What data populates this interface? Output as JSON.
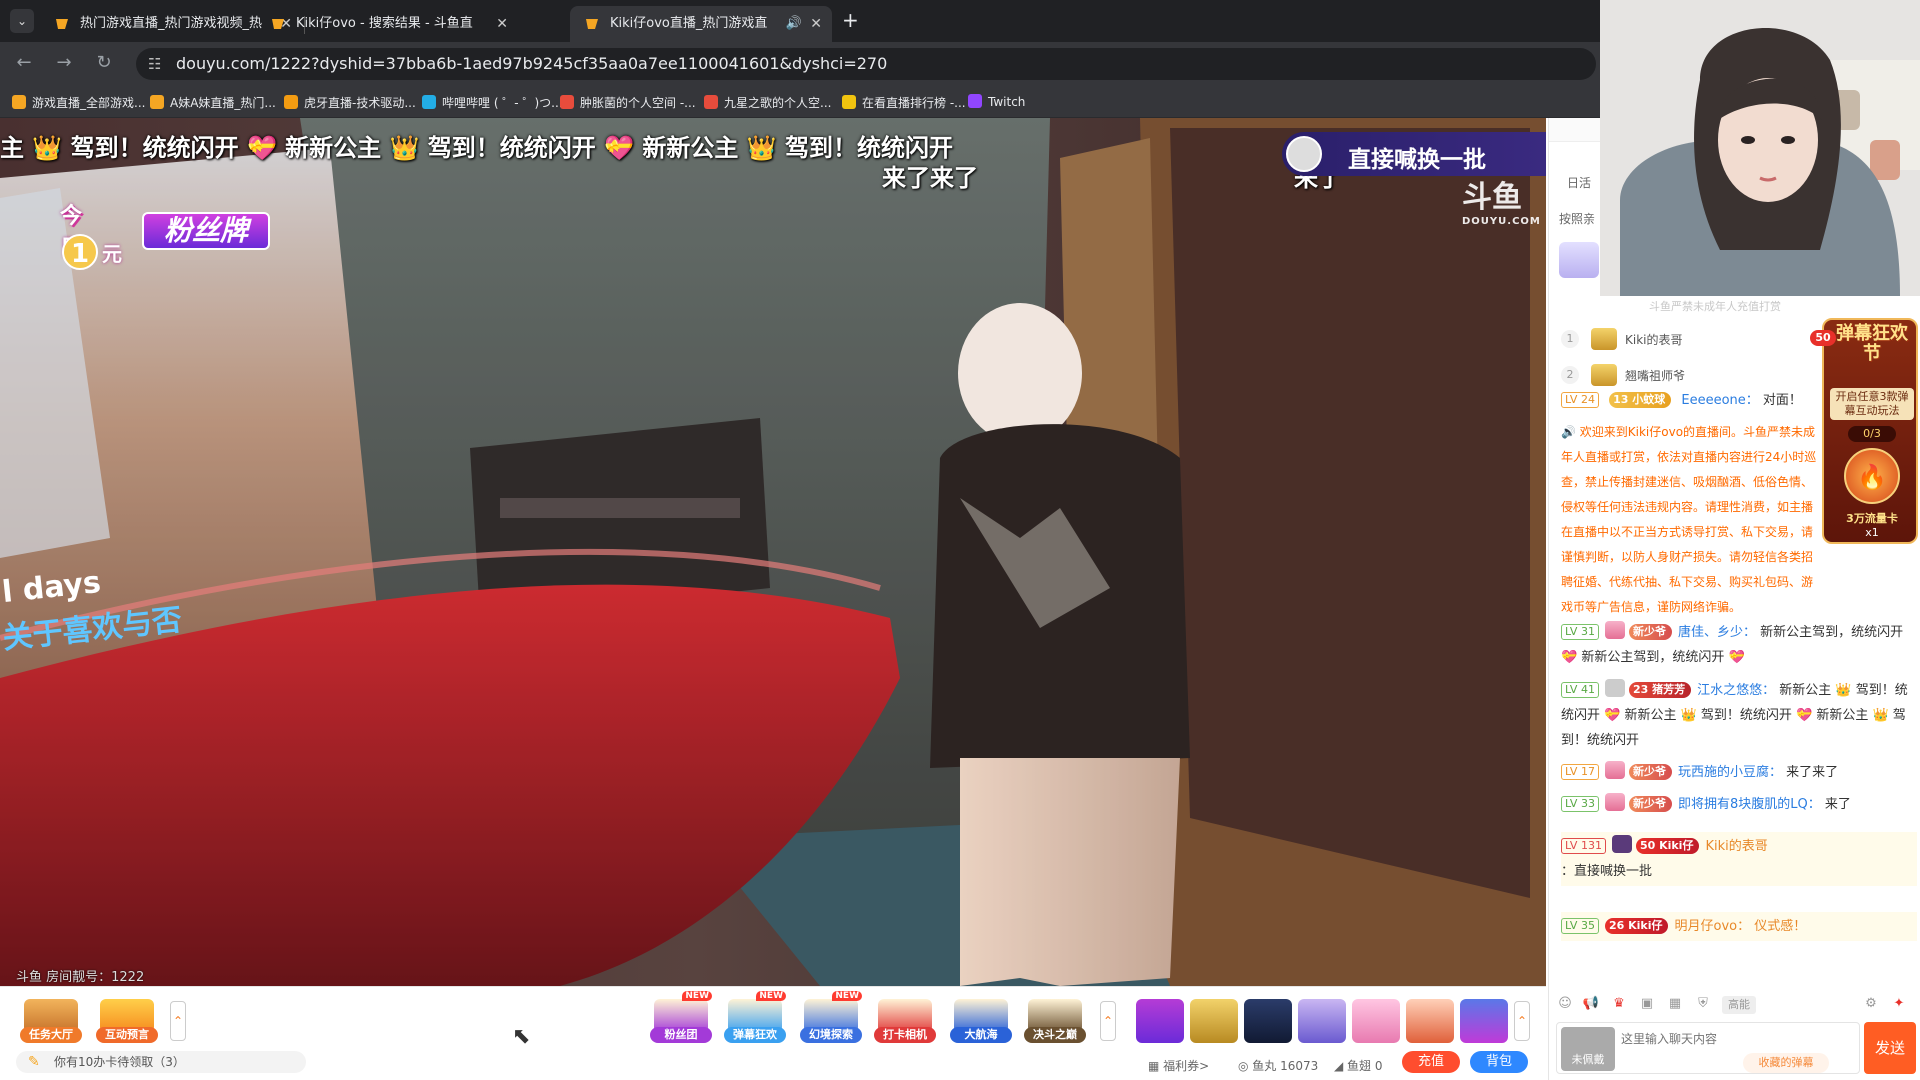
{
  "browser": {
    "tabs": [
      {
        "title": "热门游戏直播_热门游戏视频_热",
        "active": false
      },
      {
        "title": "Kiki仔ovo - 搜索结果 - 斗鱼直",
        "active": false
      },
      {
        "title": "Kiki仔ovo直播_热门游戏直",
        "active": true
      }
    ],
    "url": "douyu.com/1222?dyshid=37bba6b-1aed97b9245cf35aa0a7ee1100041601&dyshci=270",
    "bookmarks": [
      {
        "label": "游戏直播_全部游戏...",
        "color": "#f5a623"
      },
      {
        "label": "A妹A妹直播_热门...",
        "color": "#f5a623"
      },
      {
        "label": "虎牙直播-技术驱动...",
        "color": "#f39c12"
      },
      {
        "label": "哔哩哔哩 ( ゜- ゜)つ...",
        "color": "#23ade5"
      },
      {
        "label": "肿胀菌的个人空间 -...",
        "color": "#e74c3c"
      },
      {
        "label": "九星之歌的个人空...",
        "color": "#e74c3c"
      },
      {
        "label": "在看直播排行榜 -...",
        "color": "#f1c40f"
      },
      {
        "label": "Twitch",
        "color": "#9146ff"
      }
    ]
  },
  "player": {
    "danmu": [
      {
        "text": "主 👑 驾到！统统闪开 💝 新新公主 👑 驾到！统统闪开 💝 新新公主 👑 驾到！统统闪开"
      },
      {
        "text": "来了来了"
      },
      {
        "text": "来了"
      }
    ],
    "fan_badge": {
      "top": "今日",
      "num": "1",
      "unit": "元",
      "label": "粉丝牌"
    },
    "side_banner": "直接喊换一批",
    "watermark": "斗鱼",
    "watermark_sub": "DOUYU.COM",
    "overlay_line1": "l days",
    "overlay_line2": "关于喜欢与否",
    "room_no": "斗鱼 房间靓号：1222"
  },
  "bottombar": {
    "left_items": [
      {
        "label": "任务大厅",
        "color": "#f07a2a"
      },
      {
        "label": "互动预言",
        "color": "#f06a2a"
      }
    ],
    "center_items": [
      {
        "label": "粉丝团",
        "color": "#a33ad8",
        "new": true
      },
      {
        "label": "弹幕狂欢",
        "color": "#3aa0f0",
        "new": true
      },
      {
        "label": "幻境探索",
        "color": "#3a70e0",
        "new": true
      },
      {
        "label": "打卡相机",
        "color": "#e03a3a",
        "new": false
      },
      {
        "label": "大航海",
        "color": "#2a62d8",
        "new": false
      },
      {
        "label": "决斗之巅",
        "color": "#6a5030",
        "new": false
      }
    ],
    "card_text": "你有10办卡待领取（3）",
    "welfare": "福利券>",
    "yuwan": "鱼丸 16073",
    "yuchi": "鱼翅 0",
    "recharge": "充值",
    "backpack": "背包"
  },
  "chat": {
    "header_tab": "日活",
    "sort_label": "按照亲",
    "minor_notice": "斗鱼严禁未成年人充值打赏",
    "rank": [
      {
        "n": "1",
        "name": "Kiki的表哥"
      },
      {
        "n": "2",
        "name": "翘嘴祖师爷"
      }
    ],
    "partial_row": {
      "lv": "LV 24",
      "badge": "13 小蚊球",
      "user": "Eeeeeone：",
      "text": "对面！"
    },
    "system_message": "欢迎来到Kiki仔ovo的直播间。斗鱼严禁未成年人直播或打赏，依法对直播内容进行24小时巡查，禁止传播封建迷信、吸烟酗酒、低俗色情、侵权等任何违法违规内容。请理性消费，如主播在直播中以不正当方式诱导打赏、私下交易，请谨慎判断，以防人身财产损失。请勿轻信各类招聘征婚、代练代抽、私下交易、购买礼包码、游戏币等广告信息，谨防网络诈骗。",
    "messages": [
      {
        "lv": "LV 31",
        "badge": "新少爷",
        "user": "唐佳、乡少：",
        "text": "新新公主驾到，统统闪开 💝 新新公主驾到，统统闪开 💝"
      },
      {
        "lv": "LV 41",
        "badge": "23 猪芳芳",
        "user": "江水之悠悠：",
        "text": "新新公主 👑 驾到！统统闪开 💝 新新公主 👑 驾到！统统闪开 💝 新新公主 👑 驾到！统统闪开"
      },
      {
        "lv": "LV 17",
        "badge": "新少爷",
        "user": "玩西施的小豆腐：",
        "text": "来了来了"
      },
      {
        "lv": "LV 33",
        "badge": "新少爷",
        "user": "即将拥有8块腹肌的LQ：",
        "text": "来了"
      },
      {
        "lv": "LV 131",
        "badge": "50 Kiki仔",
        "user": "Kiki的表哥",
        "text": "：直接喊换一批"
      },
      {
        "lv": "LV 35",
        "badge": "26 Kiki仔",
        "user": "明月仔ovo：",
        "text": "仪式感！"
      }
    ],
    "promo": {
      "title": "弹幕狂欢节",
      "desc": "开启任意3款弹幕互动玩法",
      "progress": "0/3",
      "reward": "3万流量卡",
      "mult": "x1",
      "badge": "50"
    },
    "input_placeholder": "这里输入聊天内容",
    "collect": "收藏的弹幕",
    "send": "发送",
    "avatar_label": "未佩戴",
    "toolbar_chip": "高能"
  }
}
